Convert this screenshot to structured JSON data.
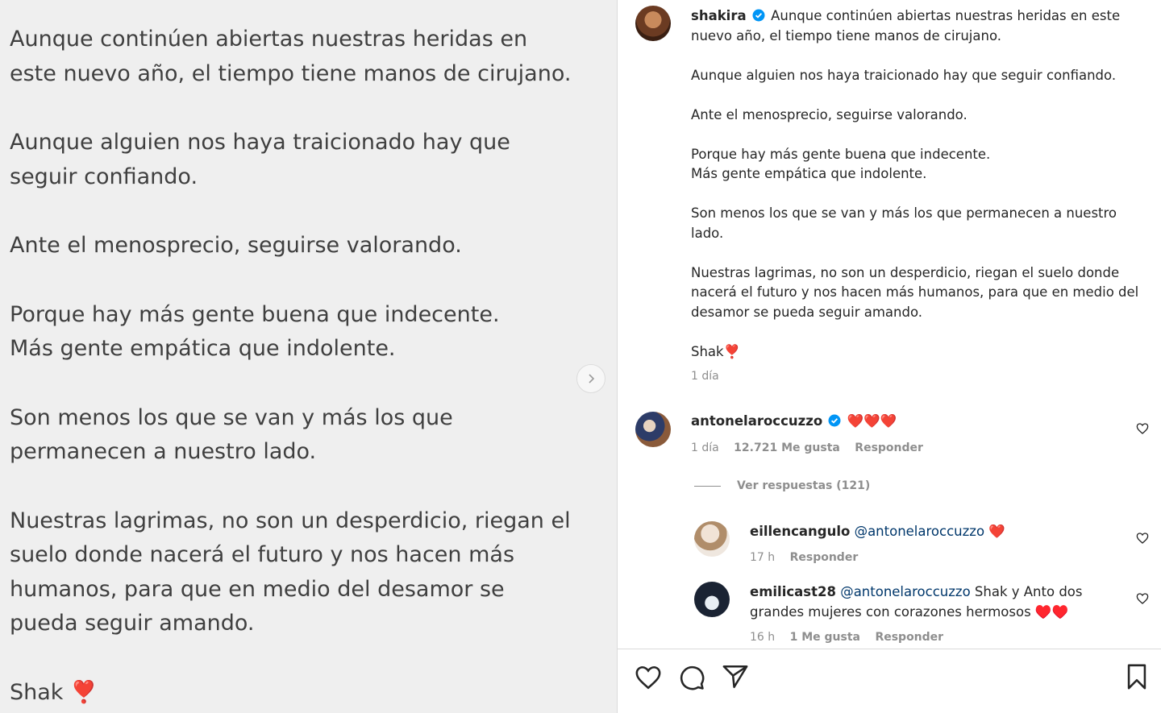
{
  "image": {
    "paragraphs": [
      [
        "Aunque continúen abiertas nuestras heridas en",
        "este nuevo año, el tiempo tiene manos de cirujano."
      ],
      [
        "Aunque alguien nos haya traicionado hay que",
        "seguir confiando."
      ],
      [
        "Ante el menosprecio, seguirse valorando."
      ],
      [
        "Porque hay más gente buena que indecente.",
        "Más gente empática que indolente."
      ],
      [
        "Son menos los que se van y más los que",
        "permanecen a nuestro lado."
      ],
      [
        "Nuestras lagrimas, no son un desperdicio, riegan el",
        "suelo donde nacerá el futuro y nos hacen más",
        "humanos, para que en medio del desamor se",
        "pueda seguir amando."
      ],
      [
        "Shak ❣️"
      ]
    ]
  },
  "post": {
    "author": "shakira",
    "caption_first": "Aunque continúen abiertas nuestras heridas en este nuevo año, el tiempo tiene manos de cirujano.",
    "caption_rest": [
      "Aunque alguien nos haya traicionado hay que seguir confiando.",
      "Ante el menosprecio, seguirse valorando.",
      "Porque hay más gente buena que indecente.\nMás gente empática que indolente.",
      "Son menos los que se van y más los que permanecen a nuestro lado.",
      "Nuestras lagrimas, no son un desperdicio, riegan el suelo donde nacerá el futuro y nos hacen más humanos, para que en medio del desamor se pueda seguir amando.",
      "Shak❣️"
    ],
    "time": "1 día"
  },
  "comments": [
    {
      "user": "antonelaroccuzzo",
      "text": "❤️❤️❤️",
      "time": "1 día",
      "likes": "12.721 Me gusta",
      "reply": "Responder",
      "view_replies": "Ver respuestas (121)"
    }
  ],
  "replies": [
    {
      "user": "eillencangulo",
      "mention": "@antonelaroccuzzo",
      "text": "❤️",
      "time": "17 h",
      "reply": "Responder"
    },
    {
      "user": "emilicast28",
      "mention": "@antonelaroccuzzo",
      "text": " Shak y Anto dos grandes mujeres con corazones hermosos ♥️♥️",
      "time": "16 h",
      "likes": "1 Me gusta",
      "reply": "Responder"
    }
  ],
  "icons": {
    "like": "heart-icon",
    "comment": "comment-icon",
    "share": "paper-plane-icon",
    "save": "bookmark-icon",
    "verified": "verified-badge-icon",
    "next": "chevron-right-icon"
  },
  "colors": {
    "verified": "#0095f6",
    "heart_red": "#ed1c24",
    "mention": "#00376b",
    "muted": "#8e8e8e"
  }
}
